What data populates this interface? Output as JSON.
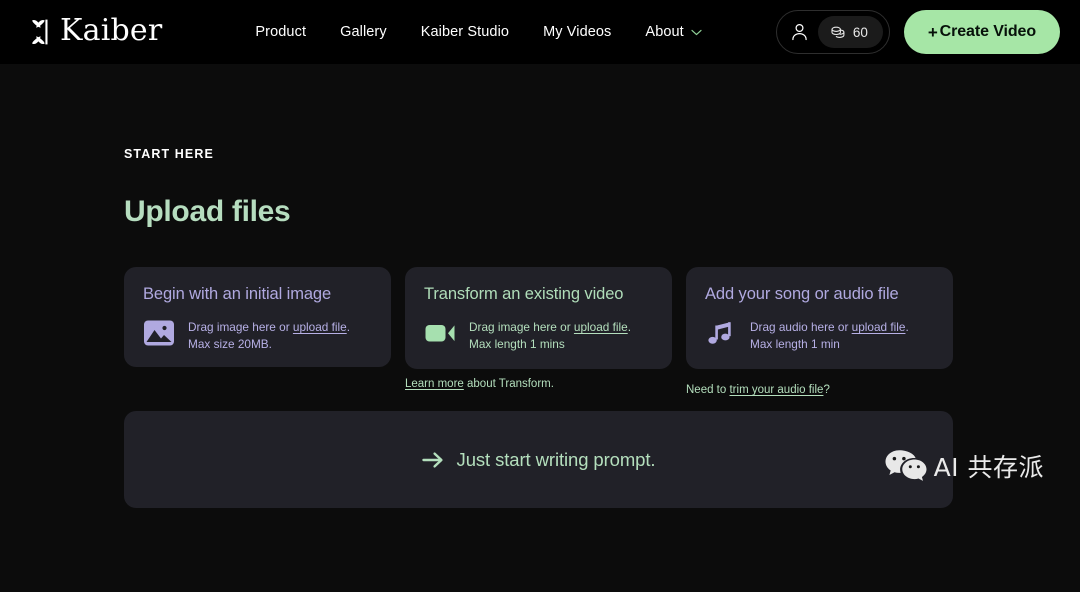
{
  "header": {
    "brand": {
      "logo_icon": "kaiber-butterfly-mark",
      "name": "Kaiber"
    },
    "nav": [
      {
        "label": "Product"
      },
      {
        "label": "Gallery"
      },
      {
        "label": "Kaiber Studio"
      },
      {
        "label": "My Videos"
      },
      {
        "label": "About",
        "icon": "chevron-down-icon"
      }
    ],
    "account": {
      "user_icon": "user-avatar-icon",
      "credits_icon": "coins-icon",
      "credits_value": "60"
    },
    "create_button": {
      "plus": "+",
      "label": "Create Video"
    }
  },
  "main": {
    "eyebrow": "START HERE",
    "title": "Upload files",
    "cards": [
      {
        "id": "initial-image",
        "title": "Begin with an initial image",
        "icon": "image-icon",
        "line1_pre": "Drag image here or ",
        "line1_link": "upload file",
        "line1_post": ".",
        "line2": "Max size 20MB."
      },
      {
        "id": "existing-video",
        "title": "Transform an existing video",
        "icon": "video-camera-icon",
        "line1_pre": "Drag image here or ",
        "line1_link": "upload file",
        "line1_post": ".",
        "line2": "Max length 1 mins"
      },
      {
        "id": "song-audio",
        "title": "Add your song or audio file",
        "icon": "music-note-icon",
        "line1_pre": "Drag audio here or ",
        "line1_link": "upload file",
        "line1_post": ".",
        "line2": "Max length 1 min"
      }
    ],
    "sublinks": {
      "learn_more_link": "Learn more",
      "learn_more_rest": " about Transform.",
      "trim_pre": "Need to ",
      "trim_link": "trim your audio file",
      "trim_post": "?"
    },
    "prompt_panel": {
      "arrow_icon": "arrow-right-icon",
      "text": "Just start writing prompt."
    }
  },
  "watermark": {
    "icon": "wechat-icon",
    "text": "AI 共存派"
  },
  "colors": {
    "page_background": "#0c0c0c",
    "header_background": "#000000",
    "card_background": "#212128",
    "accent_green": "#a6e6a6",
    "text_green": "#b4dfbd",
    "text_purple": "#b7b0e6",
    "title_green": "#b6ddbf"
  }
}
